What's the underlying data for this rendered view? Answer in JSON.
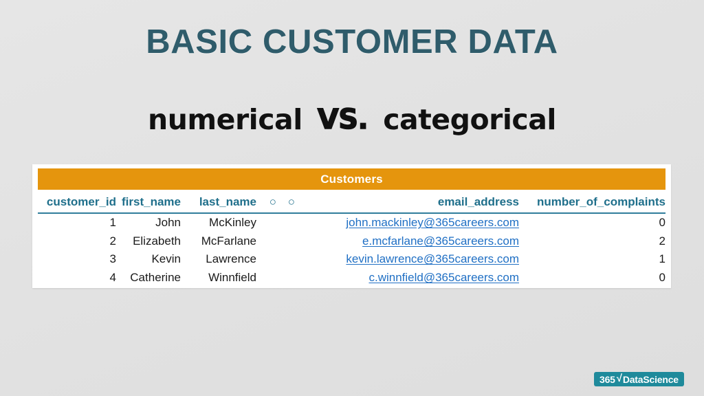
{
  "slide": {
    "title": "BASIC CUSTOMER DATA",
    "subtitle": {
      "left": "numerical",
      "middle": "VS.",
      "right": "categorical"
    },
    "background_color": "#e2e2e2",
    "title_color": "#2f5c6b"
  },
  "table": {
    "banner_label": "Customers",
    "banner_color": "#e5950d",
    "header_color": "#1f6f8b",
    "link_color": "#1f6fc4",
    "columns": [
      "customer_id",
      "first_name",
      "last_name",
      "○ ○",
      "email_address",
      "number_of_complaints"
    ],
    "rows": [
      {
        "customer_id": "1",
        "first_name": "John",
        "last_name": "McKinley",
        "email_address": "john.mackinley@365careers.com",
        "number_of_complaints": "0"
      },
      {
        "customer_id": "2",
        "first_name": "Elizabeth",
        "last_name": "McFarlane",
        "email_address": "e.mcfarlane@365careers.com",
        "number_of_complaints": "2"
      },
      {
        "customer_id": "3",
        "first_name": "Kevin",
        "last_name": "Lawrence",
        "email_address": "kevin.lawrence@365careers.com",
        "number_of_complaints": "1"
      },
      {
        "customer_id": "4",
        "first_name": "Catherine",
        "last_name": "Winnfield",
        "email_address": "c.winnfield@365careers.com",
        "number_of_complaints": "0"
      }
    ]
  },
  "logo": {
    "prefix": "365",
    "radical": "√",
    "suffix": "DataScience",
    "color": "#1f8a9b"
  }
}
